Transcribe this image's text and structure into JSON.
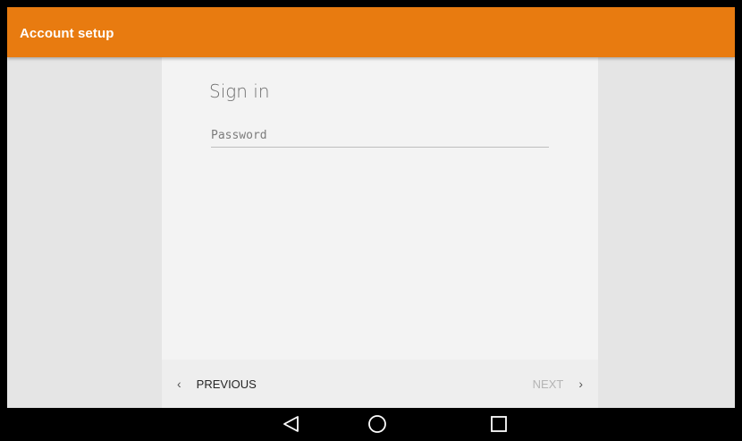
{
  "app_bar": {
    "title": "Account setup",
    "color": "#e87b10"
  },
  "card": {
    "heading": "Sign in",
    "password_field": {
      "placeholder": "Password",
      "value": ""
    }
  },
  "bottom_bar": {
    "previous_label": "PREVIOUS",
    "next_label": "NEXT",
    "previous_icon": "chevron-left-icon",
    "next_icon": "chevron-right-icon"
  },
  "system_nav": {
    "back_icon": "back-triangle-icon",
    "home_icon": "home-circle-icon",
    "recents_icon": "recents-square-icon"
  }
}
